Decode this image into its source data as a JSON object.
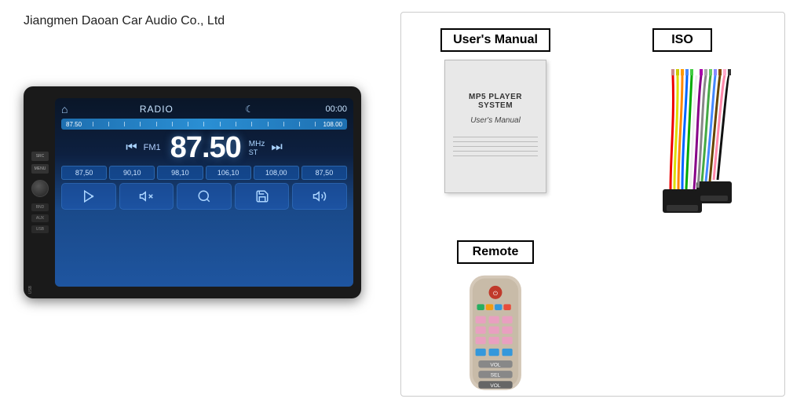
{
  "company": {
    "name": "Jiangmen Daoan Car Audio Co., Ltd"
  },
  "radio": {
    "mode": "RADIO",
    "time": "00:00",
    "freq_start": "87.50",
    "freq_end": "108.00",
    "fm_label": "FM1",
    "frequency": "87.50",
    "unit": "MHz",
    "stereo": "ST",
    "presets": [
      "87,50",
      "90,10",
      "98,10",
      "106,10",
      "108,00",
      "87,50"
    ],
    "buttons": {
      "src": "SRC",
      "menu": "MENU",
      "bnd": "BND",
      "aux": "AUX",
      "usb": "USB"
    }
  },
  "card": {
    "manual_label": "User's Manual",
    "manual_title": "MP5 PLAYER SYSTEM",
    "manual_subtitle": "User's Manual",
    "iso_label": "ISO",
    "remote_label": "Remote"
  }
}
